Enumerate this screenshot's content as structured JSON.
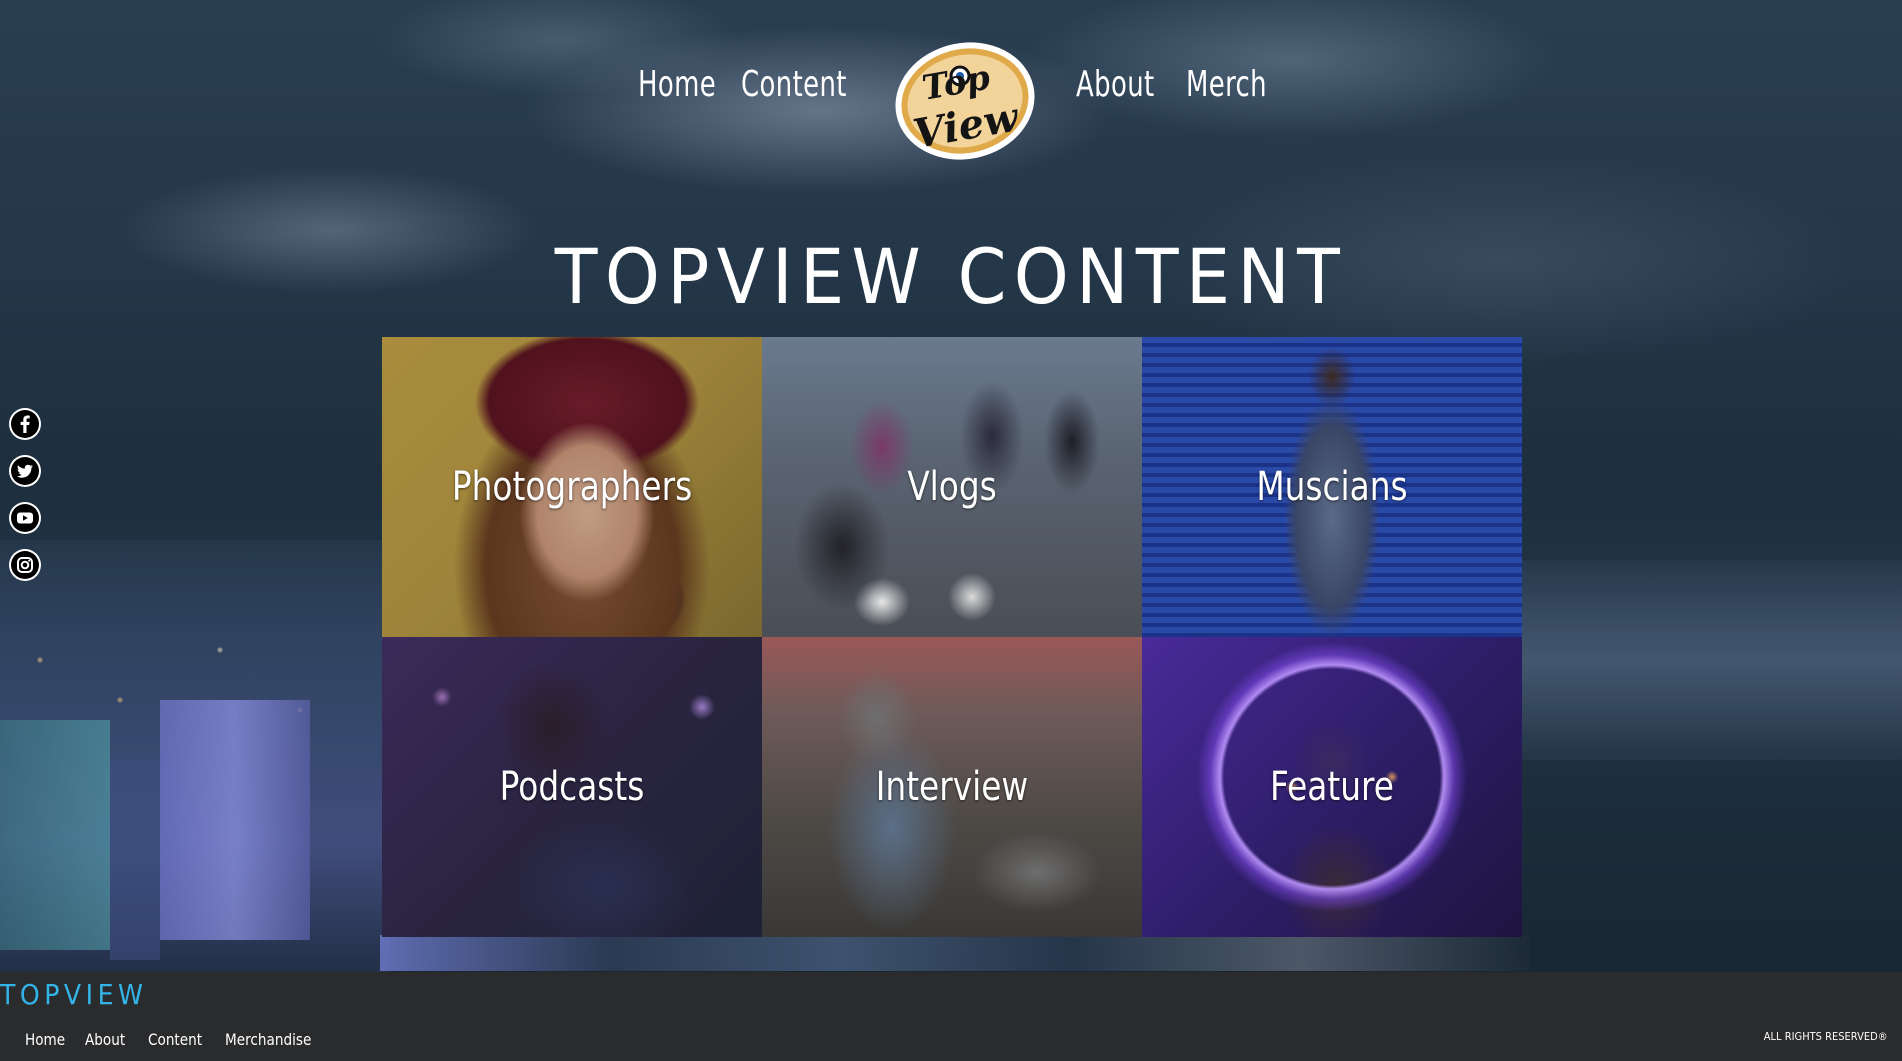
{
  "nav": {
    "home": "Home",
    "content": "Content",
    "about": "About",
    "merch": "Merch",
    "logo_text_top": "Top",
    "logo_text_bottom": "View"
  },
  "title": "TOPVIEW CONTENT",
  "social": [
    {
      "icon": "facebook-icon",
      "glyph": "f"
    },
    {
      "icon": "twitter-icon",
      "glyph": "🐦"
    },
    {
      "icon": "youtube-icon",
      "glyph": "▶"
    },
    {
      "icon": "instagram-icon",
      "glyph": "◎"
    }
  ],
  "tiles": [
    {
      "label": "Photographers"
    },
    {
      "label": "Vlogs"
    },
    {
      "label": "Muscians"
    },
    {
      "label": "Podcasts"
    },
    {
      "label": "Interview"
    },
    {
      "label": "Feature"
    }
  ],
  "footer": {
    "brand": "TOPVIEW",
    "links": [
      "Home",
      "About",
      "Content",
      "Merchandise"
    ],
    "rights": "ALL RIGHTS RESERVED®"
  },
  "colors": {
    "footer_brand": "#33b4e8",
    "footer_bg": "#2a2b2d",
    "logo_gold": "#e0a94a"
  }
}
